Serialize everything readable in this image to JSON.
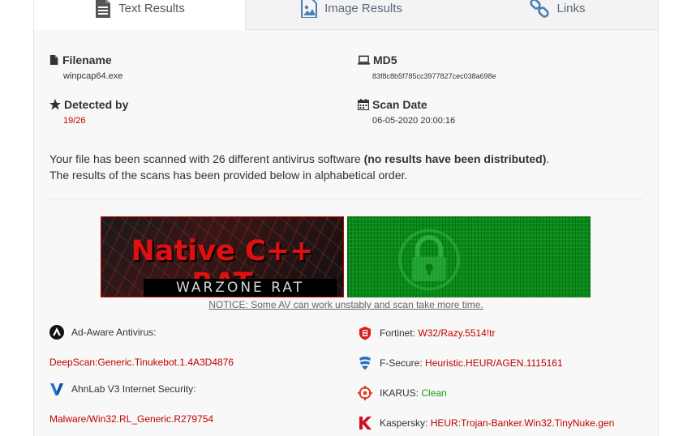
{
  "tabs": [
    {
      "label": "Text Results",
      "icon": "document-icon"
    },
    {
      "label": "Image Results",
      "icon": "image-icon"
    },
    {
      "label": "Links",
      "icon": "link-icon"
    }
  ],
  "file": {
    "filename_label": "Filename",
    "filename": "winpcap64.exe",
    "md5_label": "MD5",
    "md5": "83f8c8b5f785cc3977827cec038a698e",
    "detected_label": "Detected by",
    "detected": "19/26",
    "scandate_label": "Scan Date",
    "scandate": "06-05-2020 20:00:16"
  },
  "description": {
    "line1_prefix": "Your file has been scanned with 26 different antivirus software ",
    "line1_bold": "(no results have been distributed)",
    "line1_suffix": ".",
    "line2": "The results of the scans has been provided below in alphabetical order."
  },
  "banners": {
    "rat_title": "Native C++ RAT",
    "rat_sub": "WARZONE RAT"
  },
  "notice": "NOTICE: Some AV can work unstably and scan take more time.",
  "left_results": [
    {
      "name": "Ad-Aware Antivirus:",
      "result": "DeepScan:Generic.Tinukebot.1.4A3D4876",
      "icon": "ad-aware-icon"
    },
    {
      "name": "AhnLab V3 Internet Security:",
      "result": "Malware/Win32.RL_Generic.R279754",
      "icon": "ahnlab-icon"
    }
  ],
  "right_results": [
    {
      "name": "Fortinet:",
      "result": "W32/Razy.5514!tr",
      "status": "detected",
      "icon": "fortinet-icon"
    },
    {
      "name": "F-Secure:",
      "result": "Heuristic.HEUR/AGEN.1115161",
      "status": "detected",
      "icon": "f-secure-icon"
    },
    {
      "name": "IKARUS:",
      "result": "Clean",
      "status": "clean",
      "icon": "ikarus-icon"
    },
    {
      "name": "Kaspersky:",
      "result": "HEUR:Trojan-Banker.Win32.TinyNuke.gen",
      "status": "detected",
      "icon": "kaspersky-icon"
    }
  ],
  "colors": {
    "detected": "#c00000",
    "clean": "#14a014",
    "tab_icon": "#4a7fb5"
  }
}
